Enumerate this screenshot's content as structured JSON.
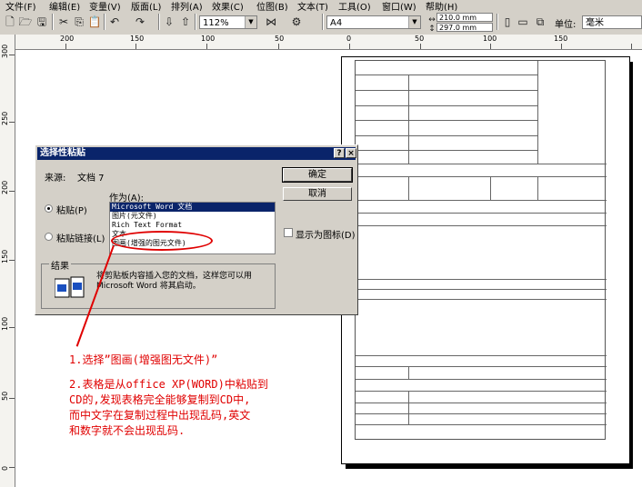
{
  "menu": {
    "items": [
      "文件(F)",
      "编辑(E)",
      "变量(V)",
      "版面(L)",
      "排列(A)",
      "效果(C)",
      "位图(B)",
      "文本(T)",
      "工具(O)",
      "窗口(W)",
      "帮助(H)"
    ]
  },
  "toolbar": {
    "zoom": "112%",
    "paper_size": "A4",
    "width_value": "210.0 mm",
    "height_value": "297.0 mm",
    "unit_label": "单位:",
    "unit_value": "毫米"
  },
  "ruler": {
    "h_labels": [
      "200",
      "150",
      "100",
      "50",
      "0",
      "50",
      "100",
      "150"
    ],
    "v_labels": [
      "300",
      "250",
      "200",
      "150",
      "100",
      "50",
      "0"
    ]
  },
  "dialog": {
    "title": "选择性粘贴",
    "help_btn": "?",
    "close_btn": "×",
    "source_label": "来源:",
    "source_value": "文档 7",
    "as_label": "作为(A):",
    "paste_radio": "粘贴(P)",
    "paste_link_radio": "粘贴链接(L)",
    "options": [
      "Microsoft Word 文档",
      "图片(元文件)",
      "Rich Text Format",
      "文本",
      "图画(增强的图元文件)"
    ],
    "ok_button": "确定",
    "cancel_button": "取消",
    "display_icon_label": "显示为图标(D)",
    "result_title": "结果",
    "result_text": "将剪贴板内容插入您的文档，这样您可以用 Microsoft Word 将其启动。"
  },
  "annotations": {
    "note1": "1.选择”图画(增强图无文件)”",
    "note2_line1": "2.表格是从office XP(WORD)中粘贴到",
    "note2_line2": "CD的,发现表格完全能够复制到CD中,",
    "note2_line3": "而中文字在复制过程中出现乱码,英文",
    "note2_line4": "和数字就不会出现乱码."
  },
  "colors": {
    "titlebar": "#0a246a",
    "annotation": "#e00000",
    "chrome": "#d4d0c8"
  }
}
